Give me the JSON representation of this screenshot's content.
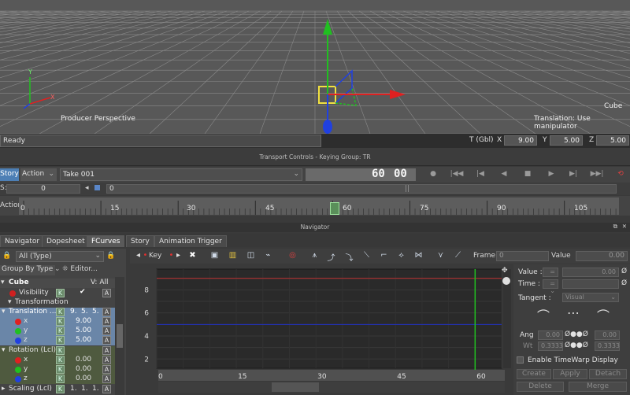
{
  "viewport": {
    "camera_label": "Producer Perspective",
    "object_label": "Cube",
    "mode_hint": "Translation: Use manipulator",
    "axis_labels": [
      "X",
      "Y"
    ]
  },
  "status": {
    "ready": "Ready",
    "t_label": "T (Gbl)",
    "x_label": "X",
    "x_value": "9.00",
    "y_label": "Y",
    "y_value": "5.00",
    "z_label": "Z",
    "z_value": "5.00"
  },
  "transport": {
    "title": "Transport Controls  -  Keying Group: TR",
    "story_tab": "Story",
    "action_tab": "Action",
    "take": "Take 001",
    "frame": "60",
    "frame_sub": "00",
    "offset_left": "0",
    "offset_right": "0",
    "row_label_left": "S:",
    "action_label": "Action"
  },
  "timeline": {
    "ticks": [
      "0",
      "15",
      "30",
      "45",
      "60",
      "75",
      "90",
      "105"
    ],
    "current_frame": 60
  },
  "navigator": {
    "title": "Navigator",
    "tabs": [
      "Navigator",
      "Dopesheet",
      "FCurves",
      "Story",
      "Animation Trigger"
    ],
    "active_tab": "FCurves"
  },
  "left_panel": {
    "filter": "All (Type)",
    "group_by": "Group By Type",
    "editor": "Editor...",
    "object": "Cube",
    "v_all": "V: All",
    "visibility": "Visibility",
    "transformation": "Transformation",
    "translation": "Translation ...",
    "translation_vals": [
      "9.",
      "5.",
      "5."
    ],
    "tx": "x",
    "tx_val": "9.00",
    "ty": "y",
    "ty_val": "5.00",
    "tz": "z",
    "tz_val": "5.00",
    "rotation": "Rotation (Lcl)",
    "rx": "x",
    "rx_val": "0.00",
    "ry": "y",
    "ry_val": "0.00",
    "rz": "z",
    "rz_val": "0.00",
    "scaling": "Scaling (Lcl)",
    "scaling_vals": [
      "1.",
      "1.",
      "1."
    ],
    "k": "K",
    "a": "A"
  },
  "fcurve_toolbar": {
    "key_label": "Key",
    "frame_label": "Frame",
    "frame_value": "0",
    "value_label": "Value",
    "value_value": "0.00"
  },
  "graph": {
    "y_ticks": [
      "8",
      "6",
      "4",
      "2"
    ],
    "x_ticks": [
      "0",
      "15",
      "30",
      "45",
      "60"
    ],
    "ylim": [
      1.2,
      9.8
    ],
    "xlim": [
      0,
      65
    ]
  },
  "right_panel": {
    "value_label": "Value :",
    "value_field": "0.00",
    "time_label": "Time :",
    "tangent_label": "Tangent :",
    "tangent_value": "Visual",
    "ang_label": "Ang",
    "ang1": "0.00",
    "ang2": "0.00",
    "wt_label": "Wt",
    "wt1": "0.3333",
    "wt2": "0.3333",
    "timewarp": "Enable TimeWarp Display",
    "create": "Create",
    "apply": "Apply",
    "detach": "Detach",
    "delete": "Delete",
    "merge": "Merge"
  },
  "colors": {
    "accent": "#4d7fb5",
    "x_axis": "#e02020",
    "y_axis": "#20c020",
    "z_axis": "#2040e0",
    "curve_red": "#c03030",
    "curve_blue": "#2030c0",
    "time_cursor": "#20c020"
  }
}
